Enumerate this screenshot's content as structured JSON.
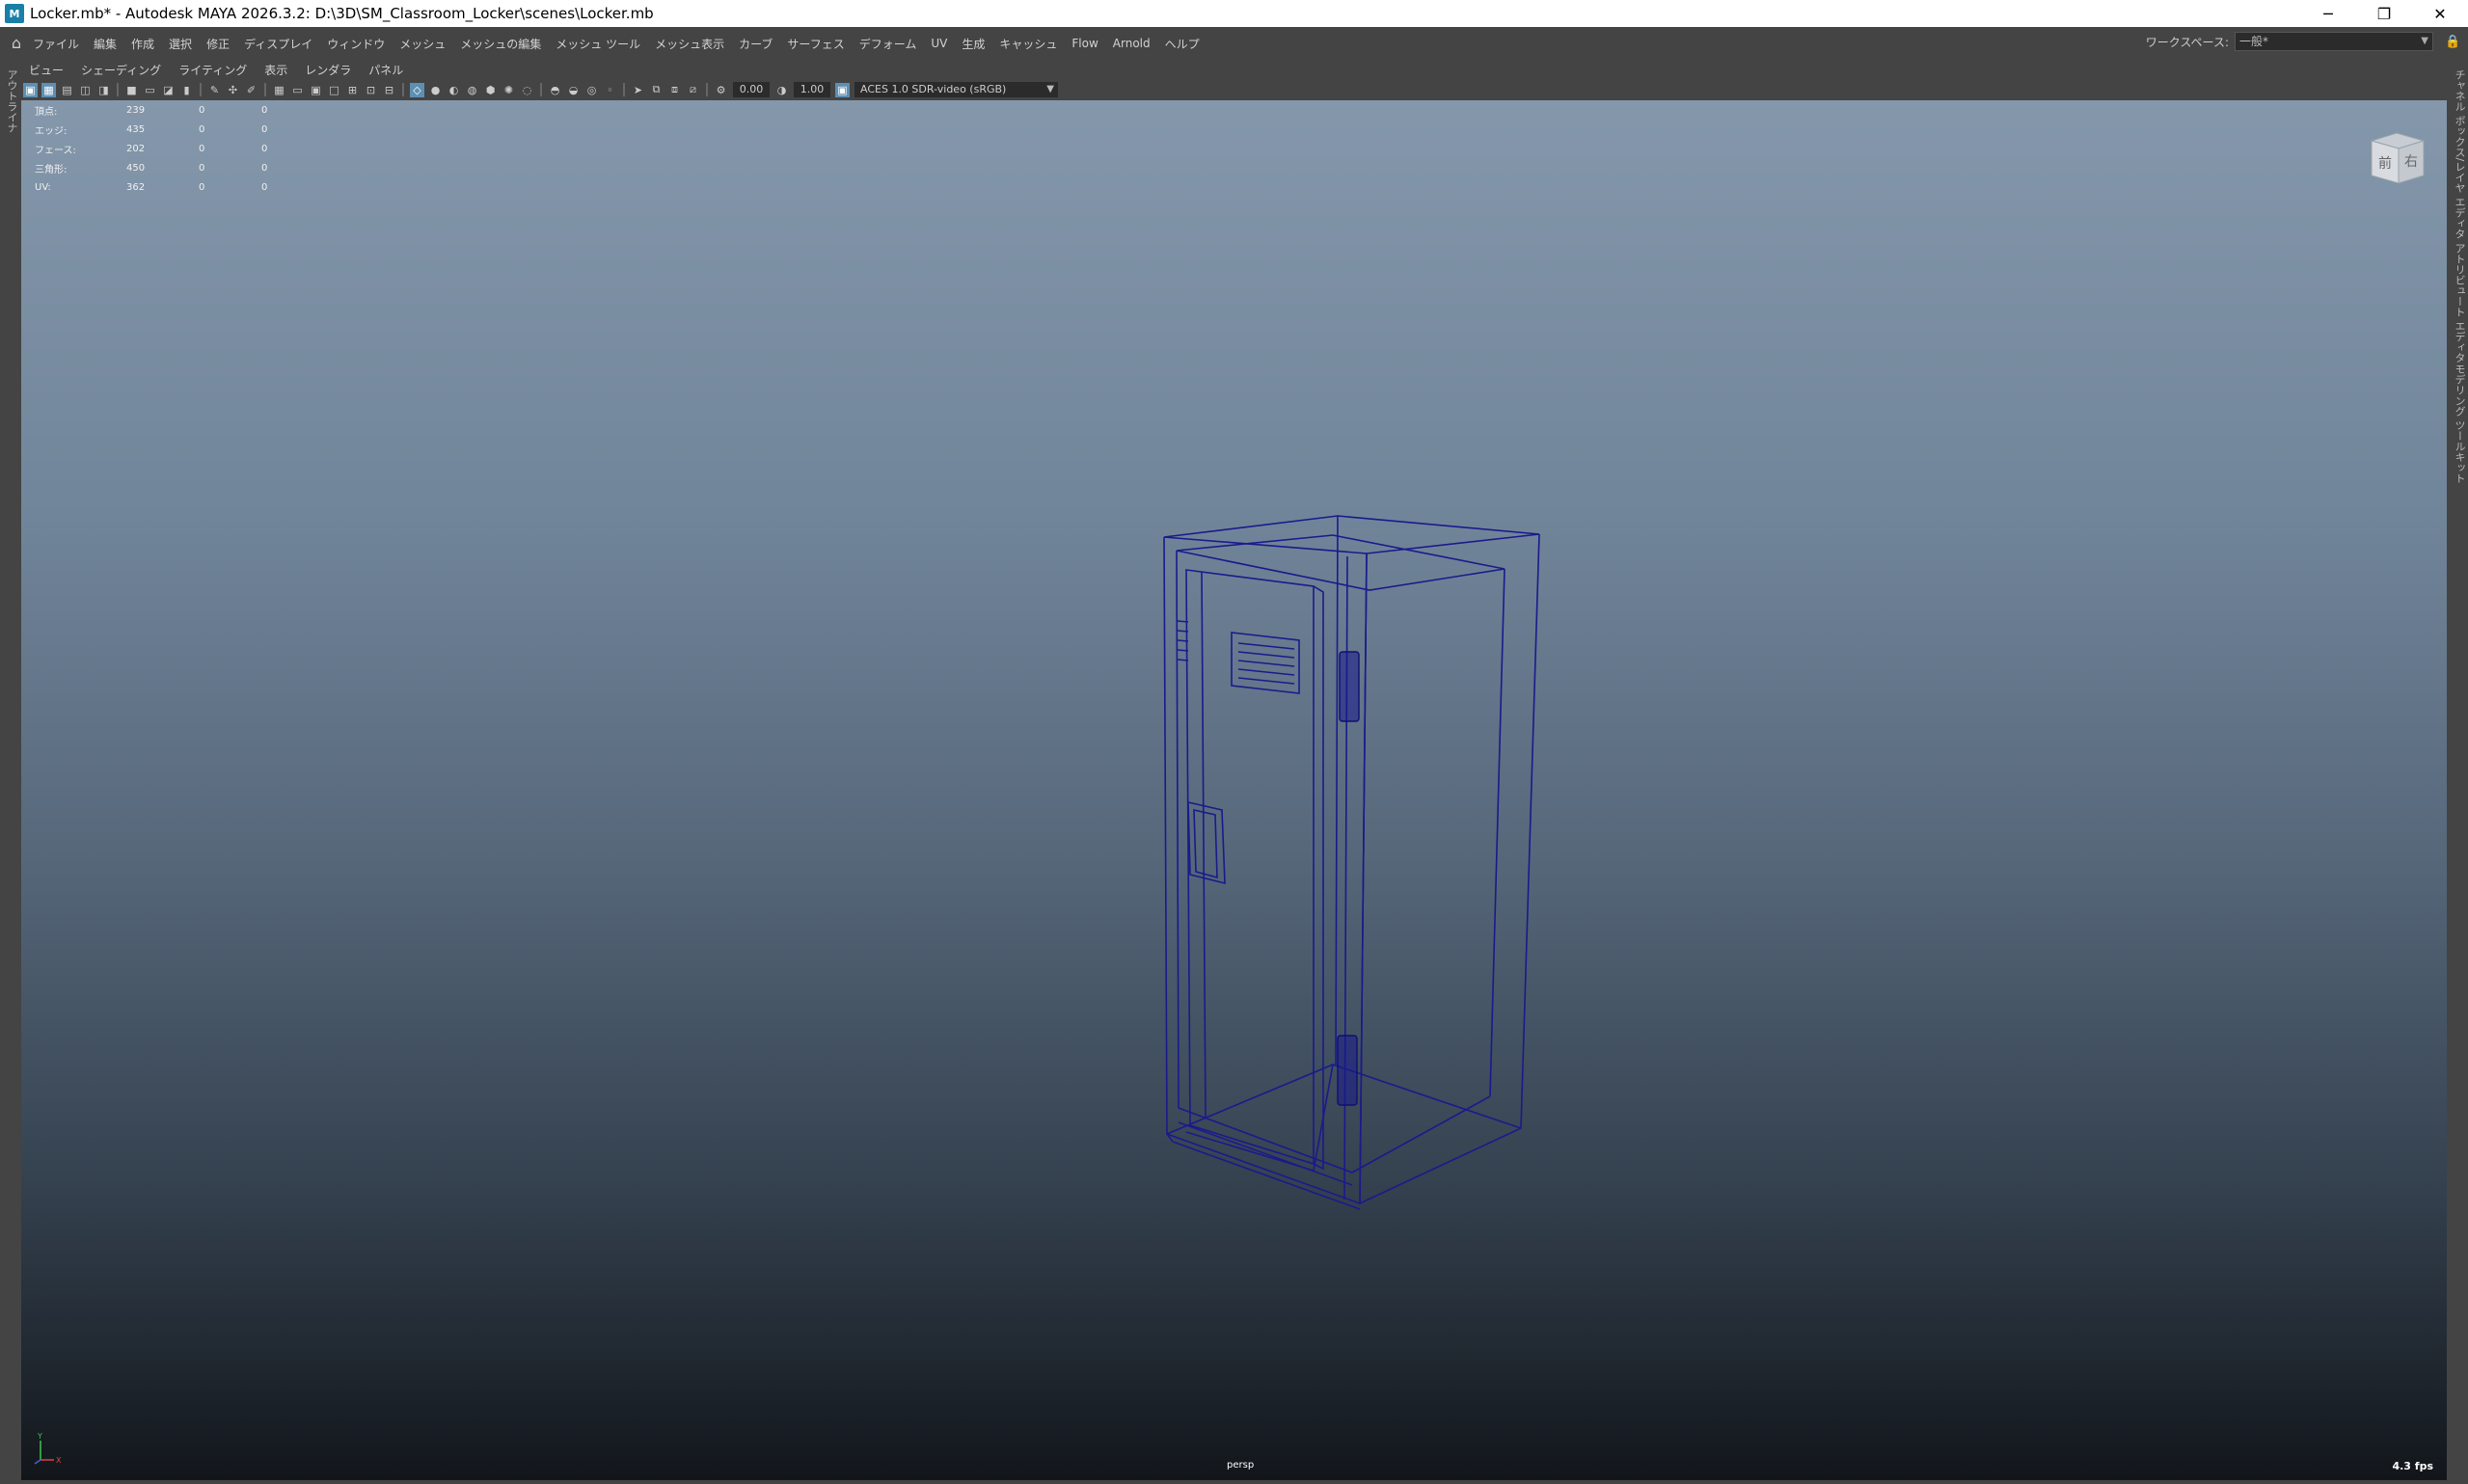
{
  "window": {
    "title": "Locker.mb* - Autodesk MAYA 2026.3.2: D:\\3D\\SM_Classroom_Locker\\scenes\\Locker.mb",
    "app_icon_letter": "M",
    "minimize": "─",
    "restore": "❐",
    "close": "✕"
  },
  "menubar": {
    "home_icon": "home-icon",
    "items": [
      "ファイル",
      "編集",
      "作成",
      "選択",
      "修正",
      "ディスプレイ",
      "ウィンドウ",
      "メッシュ",
      "メッシュの編集",
      "メッシュ ツール",
      "メッシュ表示",
      "カーブ",
      "サーフェス",
      "デフォーム",
      "UV",
      "生成",
      "キャッシュ",
      "Flow",
      "Arnold",
      "ヘルプ"
    ],
    "workspace_label": "ワークスペース:",
    "workspace_value": "一般*"
  },
  "side_panels": {
    "left_label": "アウトライナ",
    "right_labels": [
      "チャネル ボックス/レイヤ エディタ",
      "アトリビュート エディタ",
      "モデリング ツールキット"
    ]
  },
  "panel_menu": [
    "ビュー",
    "シェーディング",
    "ライティング",
    "表示",
    "レンダラ",
    "パネル"
  ],
  "panel_toolbar": {
    "exposure": "0.00",
    "gamma": "1.00",
    "color_space": "ACES 1.0 SDR-video (sRGB)"
  },
  "hud": {
    "rows": [
      {
        "label": "頂点:",
        "a": "239",
        "b": "0",
        "c": "0"
      },
      {
        "label": "エッジ:",
        "a": "435",
        "b": "0",
        "c": "0"
      },
      {
        "label": "フェース:",
        "a": "202",
        "b": "0",
        "c": "0"
      },
      {
        "label": "三角形:",
        "a": "450",
        "b": "0",
        "c": "0"
      },
      {
        "label": "UV:",
        "a": "362",
        "b": "0",
        "c": "0"
      }
    ]
  },
  "view_cube": {
    "front": "前",
    "right": "右"
  },
  "viewport": {
    "camera": "persp",
    "fps": "4.3 fps",
    "wire_color": "#1a1a8c"
  }
}
